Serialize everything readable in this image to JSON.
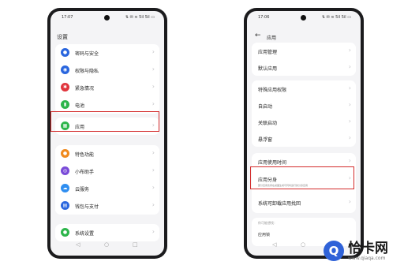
{
  "phone1": {
    "time": "17:07",
    "status_icons": "⇅ ✉ ≋ 5il 5il ▭",
    "page_title": "设置",
    "items": [
      {
        "label": "密码与安全",
        "icon": "lock-icon",
        "color": "#2a66de"
      },
      {
        "label": "权限与隐私",
        "icon": "privacy-icon",
        "color": "#2a66de"
      },
      {
        "label": "紧急情况",
        "icon": "emergency-icon",
        "color": "#e0353d"
      },
      {
        "label": "电池",
        "icon": "battery-icon",
        "color": "#2db54b"
      },
      {
        "label": "应用",
        "icon": "apps-icon",
        "color": "#2db54b"
      },
      {
        "label": "特色功能",
        "icon": "feature-icon",
        "color": "#f08a1e"
      },
      {
        "label": "小布助手",
        "icon": "assistant-icon",
        "color": "#7a4bd8"
      },
      {
        "label": "云服务",
        "icon": "cloud-icon",
        "color": "#2f8ef0"
      },
      {
        "label": "钱包与支付",
        "icon": "wallet-icon",
        "color": "#2a66de"
      },
      {
        "label": "系统设置",
        "icon": "system-icon",
        "color": "#2db54b"
      }
    ]
  },
  "phone2": {
    "time": "17:06",
    "status_icons": "⇅ ✉ ≋ 5il 5il ▭",
    "title": "应用",
    "items": [
      {
        "label": "应用管理"
      },
      {
        "label": "默认应用"
      },
      {
        "label": "特殊应用权限"
      },
      {
        "label": "自启动"
      },
      {
        "label": "关联启动"
      },
      {
        "label": "悬浮窗"
      },
      {
        "label": "应用使用时间"
      },
      {
        "label": "应用分身",
        "sub": "部分应用支持在桌面生成可同时运行的分身应用"
      },
      {
        "label": "系统可卸载应用找回"
      }
    ],
    "section_hint": "你可能想找：",
    "hint_link": "应用锁"
  },
  "nav": {
    "back": "◁",
    "home": "○",
    "recent": "□"
  },
  "brand": {
    "name": "恰卡网",
    "url": "www.qiaqa.com",
    "logo_color": "#2f62d8"
  },
  "highlight_color": "#d32b2b"
}
